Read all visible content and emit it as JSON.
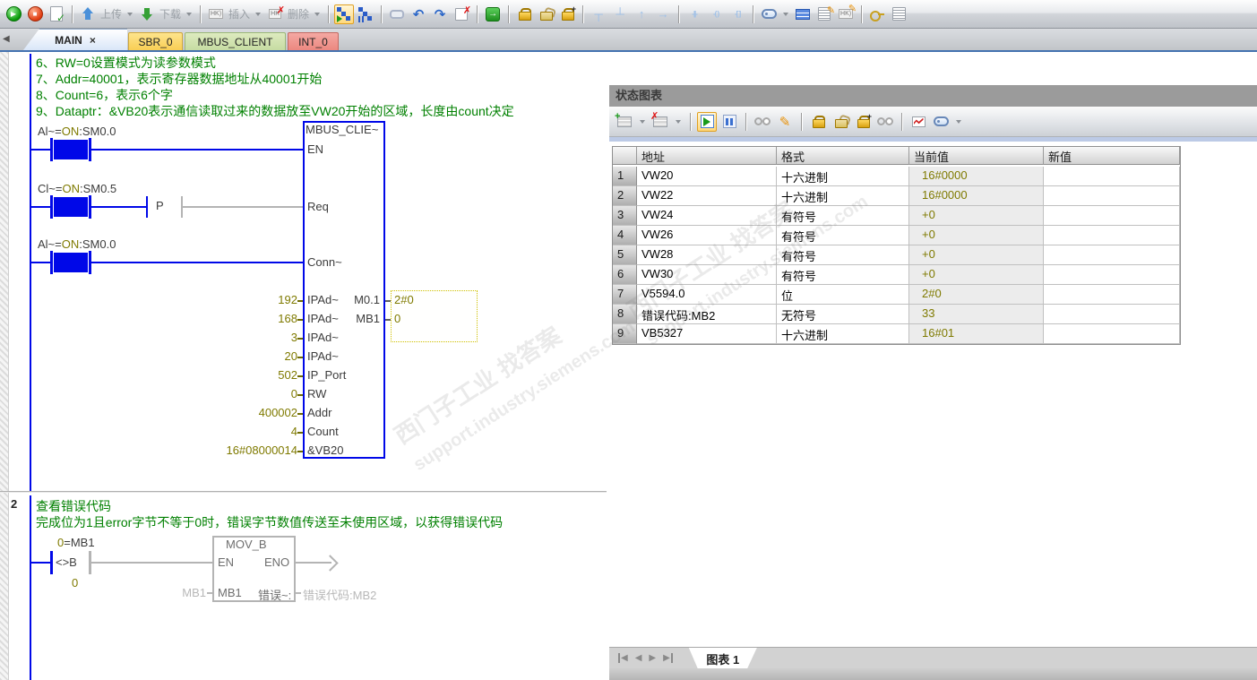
{
  "toolbar": {
    "upload_label": "上传",
    "download_label": "下载",
    "insert_label": "插入",
    "delete_label": "删除"
  },
  "tabs": {
    "main": "MAIN",
    "close": "×",
    "sbr0": "SBR_0",
    "mbus": "MBUS_CLIENT",
    "int0": "INT_0"
  },
  "network1": {
    "comments": [
      "6、RW=0设置模式为读参数模式",
      "7、Addr=40001，表示寄存器数据地址从40001开始",
      "8、Count=6，表示6个字",
      "9、Dataptr：&VB20表示通信读取过来的数据放至VW20开始的区域，长度由count决定"
    ],
    "contact_en": {
      "sym": "Al~=",
      "val": "ON",
      "addr": ":SM0.0"
    },
    "contact_req": {
      "sym": "Cl~=",
      "val": "ON",
      "addr": ":SM0.5",
      "edge": "P"
    },
    "contact_conn": {
      "sym": "Al~=",
      "val": "ON",
      "addr": ":SM0.0"
    },
    "block": {
      "title": "MBUS_CLIE~",
      "pin_en": "EN",
      "pin_req": "Req",
      "pin_conn": "Conn~",
      "params": [
        {
          "value": "192",
          "pin": "IPAd~"
        },
        {
          "value": "168",
          "pin": "IPAd~"
        },
        {
          "value": "3",
          "pin": "IPAd~"
        },
        {
          "value": "20",
          "pin": "IPAd~"
        },
        {
          "value": "502",
          "pin": "IP_Port"
        },
        {
          "value": "0",
          "pin": "RW"
        },
        {
          "value": "400002",
          "pin": "Addr"
        },
        {
          "value": "4",
          "pin": "Count"
        },
        {
          "value": "16#08000014",
          "pin": "&VB20"
        }
      ],
      "outputs": [
        {
          "operand": "M0.1",
          "value": "2#0"
        },
        {
          "operand": "MB1",
          "value": "0"
        }
      ]
    }
  },
  "network2": {
    "number": "2",
    "comments": [
      "查看错误代码",
      "完成位为1且error字节不等于0时，错误字节数值传送至未使用区域，以获得错误代码"
    ],
    "compare": {
      "above_value": "0",
      "above_operand": "=MB1",
      "op": "<>B",
      "below_value": "0"
    },
    "mov": {
      "title": "MOV_B",
      "pin_en": "EN",
      "pin_eno": "ENO",
      "pin_in": "MB1",
      "pin_out": "错误~:",
      "in_operand": "MB1",
      "out_operand": "错误代码:MB2"
    }
  },
  "panel": {
    "title": "状态图表",
    "table": {
      "headers": [
        "地址",
        "格式",
        "当前值",
        "新值"
      ],
      "rows": [
        {
          "n": "1",
          "addr": "VW20",
          "fmt": "十六进制",
          "val": "16#0000",
          "newval": ""
        },
        {
          "n": "2",
          "addr": "VW22",
          "fmt": "十六进制",
          "val": "16#0000",
          "newval": ""
        },
        {
          "n": "3",
          "addr": "VW24",
          "fmt": "有符号",
          "val": "+0",
          "newval": ""
        },
        {
          "n": "4",
          "addr": "VW26",
          "fmt": "有符号",
          "val": "+0",
          "newval": ""
        },
        {
          "n": "5",
          "addr": "VW28",
          "fmt": "有符号",
          "val": "+0",
          "newval": ""
        },
        {
          "n": "6",
          "addr": "VW30",
          "fmt": "有符号",
          "val": "+0",
          "newval": ""
        },
        {
          "n": "7",
          "addr": "V5594.0",
          "fmt": "位",
          "val": "2#0",
          "newval": ""
        },
        {
          "n": "8",
          "addr": "错误代码:MB2",
          "fmt": "无符号",
          "val": "33",
          "newval": ""
        },
        {
          "n": "9",
          "addr": "VB5327",
          "fmt": "十六进制",
          "val": "16#01",
          "newval": ""
        }
      ]
    },
    "bottom_tab": "图表 1"
  },
  "watermark": {
    "cn": "西门子工业 找答案",
    "url": "support.industry.siemens.com"
  }
}
